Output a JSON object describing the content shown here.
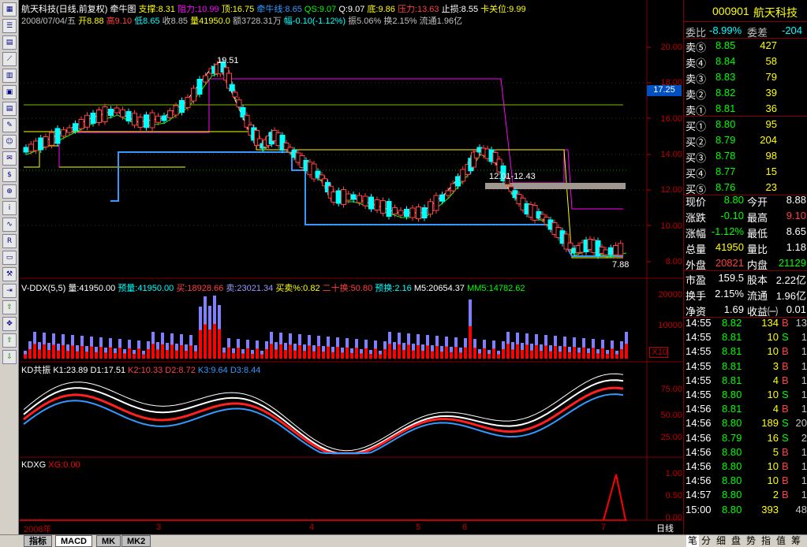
{
  "stock": {
    "code": "000901",
    "name": "航天科技",
    "title": "航天科技(日线,前复权)",
    "mode": "牵牛图",
    "support": "支撑:8.31",
    "resist": "阻力:10.99",
    "top": "顶:16.75",
    "line": "牵牛线:8.65",
    "qs": "QS:9.07",
    "q": "Q:9.07",
    "bottom": "底:9.86",
    "press": "压力:13.63",
    "stop": "止损:8.55",
    "card": "卡关位:9.99",
    "date": "2008/07/04/五",
    "open": "开8.88",
    "high": "高9.10",
    "low": "低8.65",
    "close": "收8.85",
    "vol": "量41950.0",
    "amt": "额3728.31万",
    "chg": "幅-0.10(-1.12%)",
    "amp": "振5.06%",
    "turn": "换2.15%",
    "flow": "流通1.96亿",
    "hi_mark": "19.51",
    "lo_mark": "7.88",
    "range_mark": "12.01-12.43",
    "price_tag": "17.25"
  },
  "axis": {
    "price": [
      "20.00",
      "18.00",
      "16.00",
      "14.00",
      "12.00",
      "10.00",
      "8.00"
    ],
    "vol": [
      "20000",
      "10000"
    ],
    "vol_unit": "X10",
    "kd": [
      "75.00",
      "50.00",
      "25.00"
    ],
    "kdxg": [
      "1.00",
      "0.50",
      "0.00"
    ],
    "x": [
      "2008年",
      "3",
      "4",
      "5",
      "6",
      "7"
    ],
    "period": "日线"
  },
  "ddx": {
    "name": "V-DDX(5,5)",
    "vol": "量:41950.00",
    "pred": "预量:41950.00",
    "buy": "买:18928.66",
    "sell": "卖:23021.34",
    "ratio": "买卖%:0.82",
    "twenty": "二十换:50.80",
    "predturn": "预换:2.16",
    "m5": "M5:20654.37",
    "mm5": "MM5:14782.62"
  },
  "kd": {
    "name": "KD共振",
    "k1": "K1:23.89",
    "d1": "D1:17.51",
    "k2": "K2:10.33",
    "d2": "D2:8.72",
    "k3": "K3:9.64",
    "d3": "D3:8.44"
  },
  "kdxg": {
    "name": "KDXG",
    "xg": "XG:0.00"
  },
  "quote": {
    "webi": {
      "label": "委比",
      "value": "-8.99%",
      "label2": "委差",
      "value2": "-204"
    },
    "sells": [
      {
        "label": "卖⑤",
        "price": "8.85",
        "vol": "427"
      },
      {
        "label": "卖④",
        "price": "8.84",
        "vol": "58"
      },
      {
        "label": "卖③",
        "price": "8.83",
        "vol": "79"
      },
      {
        "label": "卖②",
        "price": "8.82",
        "vol": "39"
      },
      {
        "label": "卖①",
        "price": "8.81",
        "vol": "36"
      }
    ],
    "buys": [
      {
        "label": "买①",
        "price": "8.80",
        "vol": "95"
      },
      {
        "label": "买②",
        "price": "8.79",
        "vol": "204"
      },
      {
        "label": "买③",
        "price": "8.78",
        "vol": "98"
      },
      {
        "label": "买④",
        "price": "8.77",
        "vol": "15"
      },
      {
        "label": "买⑤",
        "price": "8.76",
        "vol": "23"
      }
    ],
    "stats": [
      {
        "a": "现价",
        "av": "8.80",
        "b": "今开",
        "bv": "8.88"
      },
      {
        "a": "涨跌",
        "av": "-0.10",
        "b": "最高",
        "bv": "9.10"
      },
      {
        "a": "涨幅",
        "av": "-1.12%",
        "b": "最低",
        "bv": "8.65"
      },
      {
        "a": "总量",
        "av": "41950",
        "b": "量比",
        "bv": "1.18"
      },
      {
        "a": "外盘",
        "av": "20821",
        "b": "内盘",
        "bv": "21129"
      }
    ],
    "fund": [
      {
        "a": "市盈",
        "av": "159.5",
        "b": "股本",
        "bv": "2.22亿"
      },
      {
        "a": "换手",
        "av": "2.15%",
        "b": "流通",
        "bv": "1.96亿"
      },
      {
        "a": "净资",
        "av": "1.69",
        "b": "收益㈠",
        "bv": "0.01"
      }
    ],
    "ticks": [
      {
        "t": "14:55",
        "p": "8.82",
        "v": "134",
        "s": "B",
        "n": "13"
      },
      {
        "t": "14:55",
        "p": "8.81",
        "v": "10",
        "s": "S",
        "n": "1"
      },
      {
        "t": "14:55",
        "p": "8.81",
        "v": "10",
        "s": "B",
        "n": "1"
      },
      {
        "t": "14:55",
        "p": "8.81",
        "v": "3",
        "s": "B",
        "n": "1"
      },
      {
        "t": "14:55",
        "p": "8.81",
        "v": "4",
        "s": "B",
        "n": "1"
      },
      {
        "t": "14:55",
        "p": "8.80",
        "v": "10",
        "s": "S",
        "n": "1"
      },
      {
        "t": "14:56",
        "p": "8.81",
        "v": "4",
        "s": "B",
        "n": "1"
      },
      {
        "t": "14:56",
        "p": "8.80",
        "v": "189",
        "s": "S",
        "n": "20"
      },
      {
        "t": "14:56",
        "p": "8.79",
        "v": "16",
        "s": "S",
        "n": "2"
      },
      {
        "t": "14:56",
        "p": "8.80",
        "v": "5",
        "s": "B",
        "n": "1"
      },
      {
        "t": "14:56",
        "p": "8.80",
        "v": "10",
        "s": "B",
        "n": "1"
      },
      {
        "t": "14:56",
        "p": "8.80",
        "v": "10",
        "s": "B",
        "n": "1"
      },
      {
        "t": "14:57",
        "p": "8.80",
        "v": "2",
        "s": "B",
        "n": "1"
      },
      {
        "t": "15:00",
        "p": "8.80",
        "v": "393",
        "s": "",
        "n": "48"
      }
    ]
  },
  "tabs": {
    "bottom": [
      "指标",
      "MACD",
      "MK",
      "MK2"
    ],
    "right": [
      "笔",
      "分",
      "细",
      "盘",
      "势",
      "指",
      "值",
      "筹"
    ]
  }
}
